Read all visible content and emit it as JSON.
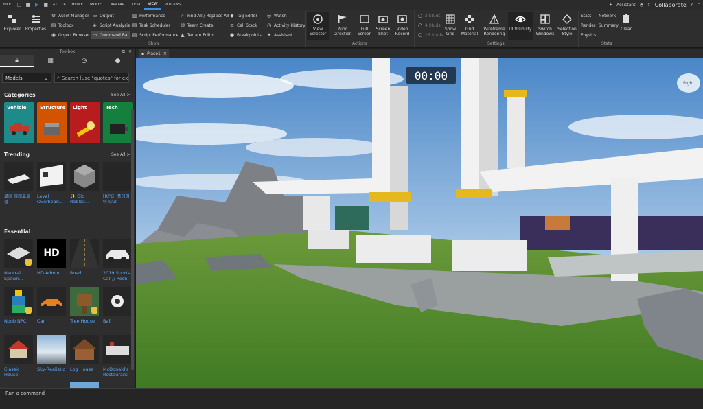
{
  "menubar": {
    "file": "FILE",
    "tabs": [
      "HOME",
      "MODEL",
      "AVATAR",
      "TEST",
      "VIEW",
      "PLUGINS"
    ],
    "active_tab": "VIEW",
    "assistant": "Assistant",
    "collaborate": "Collaborate"
  },
  "ribbon": {
    "explorer": "Explorer",
    "properties": "Properties",
    "show_items": [
      "Asset Manager",
      "Toolbox",
      "Object Browser",
      "Output",
      "Script Analysis",
      "Command Bar",
      "Performance",
      "Task Scheduler",
      "Script Performance",
      "Find All / Replace All",
      "Team Create",
      "Terrain Editor",
      "Tag Editor",
      "Call Stack",
      "Breakpoints",
      "Watch",
      "Activity History",
      "Assistant"
    ],
    "show_group": "Show",
    "actions": [
      "View Selector",
      "Wind Direction",
      "Full Screen",
      "Screen Shot",
      "Video Record"
    ],
    "actions_group": "Actions",
    "studs": [
      "2 Studs",
      "4 Studs",
      "16 Studs"
    ],
    "settings": [
      "Show Grid",
      "Grid Material",
      "Wireframe Rendering",
      "UI Visibility",
      "Switch Windows",
      "Selection Style"
    ],
    "settings_group": "Settings",
    "stats_items": [
      "Stats",
      "Network",
      "Render",
      "Summary",
      "Physics"
    ],
    "clear": "Clear",
    "stats_group": "Stats"
  },
  "toolbox": {
    "title": "Toolbox",
    "dropdown": "Models",
    "search_placeholder": "Search (use \"quotes\" for exact",
    "categories_title": "Categories",
    "see_all": "See All >",
    "categories": [
      "Vehicle",
      "Structure",
      "Light",
      "Tech"
    ],
    "trending_title": "Trending",
    "trending": [
      "로비 텔레포트 블",
      "Level Overhead...",
      "✨ Old Roblox...",
      "[RPG] 플레이어 GUI"
    ],
    "essential_title": "Essential",
    "essential": [
      "Neutral Spawn...",
      "HD Admin",
      "Road",
      "2019 Sports Car // Rosh",
      "Noob NPC",
      "Car",
      "Tree House",
      "Ball",
      "Classic House",
      "Sky-Realistic",
      "Log House",
      "McDonald's Restaurant"
    ],
    "hd_admin_logo": "HD"
  },
  "document": {
    "tab": "Place1"
  },
  "viewport": {
    "timer": "00:00",
    "cube_label": "Right"
  },
  "command_bar": {
    "placeholder": "Run a command"
  }
}
